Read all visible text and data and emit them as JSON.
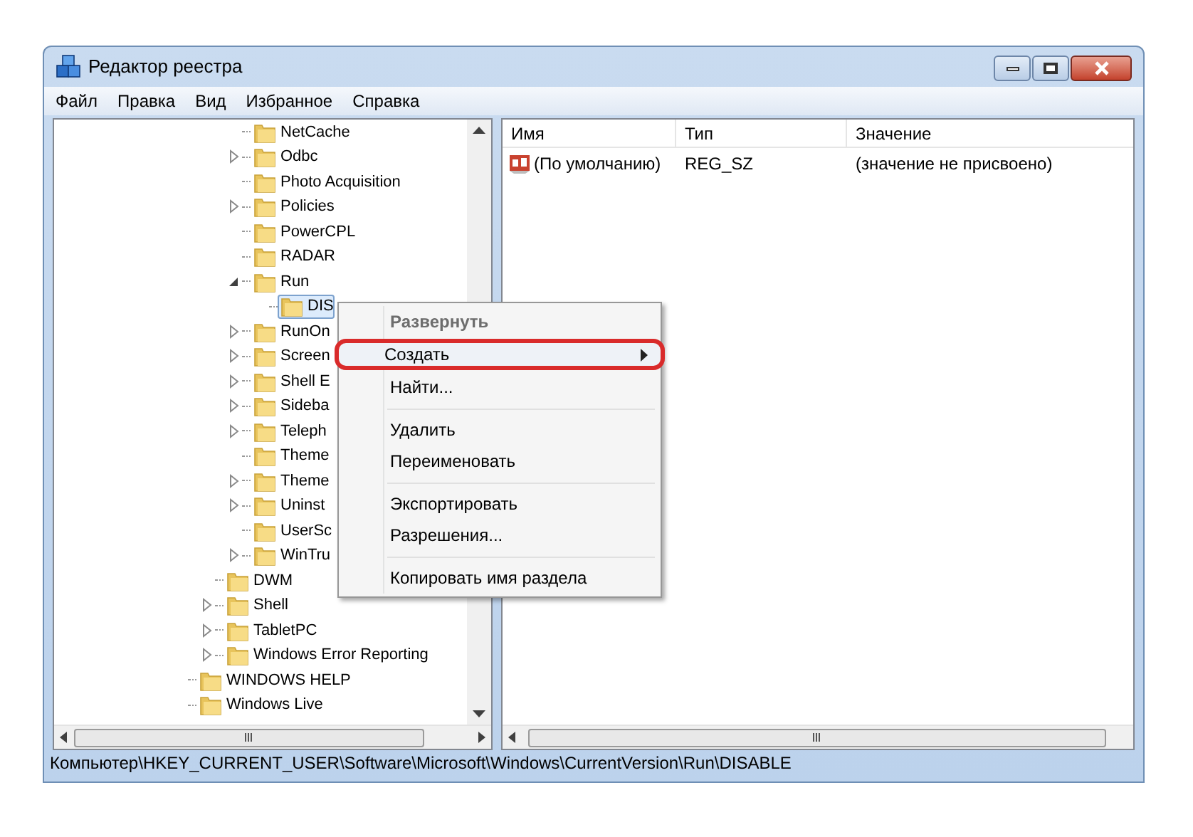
{
  "window": {
    "title": "Редактор реестра"
  },
  "menu_bar": [
    {
      "label": "Файл"
    },
    {
      "label": "Правка"
    },
    {
      "label": "Вид"
    },
    {
      "label": "Избранное"
    },
    {
      "label": "Справка"
    }
  ],
  "tree": {
    "items": [
      {
        "children": [
          {
            "children": [
              {
                "label": "NetCache",
                "selected": false
              },
              {
                "label": "Odbc",
                "expanded": false,
                "selected": false
              },
              {
                "label": "Photo Acquisition",
                "selected": false
              },
              {
                "label": "Policies",
                "expanded": false,
                "selected": false
              },
              {
                "label": "PowerCPL",
                "selected": false
              },
              {
                "label": "RADAR",
                "selected": false
              },
              {
                "label": "Run",
                "expanded": true,
                "selected": false,
                "children": [
                  {
                    "label": "DIS",
                    "selected": true
                  }
                ]
              },
              {
                "label": "RunOn",
                "expanded": false,
                "selected": false
              },
              {
                "label": "Screen",
                "expanded": false,
                "selected": false
              },
              {
                "label": "Shell E",
                "expanded": false,
                "selected": false
              },
              {
                "label": "Sideba",
                "expanded": false,
                "selected": false
              },
              {
                "label": "Teleph",
                "expanded": false,
                "selected": false
              },
              {
                "label": "Theme",
                "selected": false
              },
              {
                "label": "Theme",
                "expanded": false,
                "selected": false
              },
              {
                "label": "Uninst",
                "expanded": false,
                "selected": false
              },
              {
                "label": "UserSc",
                "selected": false
              },
              {
                "label": "WinTru",
                "expanded": false,
                "selected": false
              }
            ]
          },
          {
            "label": "DWM",
            "selected": false
          },
          {
            "label": "Shell",
            "expanded": false,
            "selected": false
          },
          {
            "label": "TabletPC",
            "expanded": false,
            "selected": false
          },
          {
            "label": "Windows Error Reporting",
            "expanded": false,
            "selected": false
          }
        ]
      },
      {
        "label": "WINDOWS HELP",
        "selected": false
      },
      {
        "label": "Windows Live",
        "selected": false
      }
    ]
  },
  "values_table": {
    "columns": [
      "Имя",
      "Тип",
      "Значение"
    ],
    "rows": [
      {
        "name": "(По умолчанию)",
        "type": "REG_SZ",
        "data": "(значение не присвоено)"
      }
    ]
  },
  "context_menu": {
    "items": [
      {
        "kind": "item",
        "label": "Развернуть",
        "default": true,
        "submenu": false,
        "highlighted": false
      },
      {
        "kind": "item",
        "label": "Создать",
        "default": false,
        "submenu": true,
        "highlighted": true
      },
      {
        "kind": "item",
        "label": "Найти...",
        "default": false,
        "submenu": false,
        "highlighted": false
      },
      {
        "kind": "separator"
      },
      {
        "kind": "item",
        "label": "Удалить",
        "default": false,
        "submenu": false,
        "highlighted": false
      },
      {
        "kind": "item",
        "label": "Переименовать",
        "default": false,
        "submenu": false,
        "highlighted": false
      },
      {
        "kind": "separator"
      },
      {
        "kind": "item",
        "label": "Экспортировать",
        "default": false,
        "submenu": false,
        "highlighted": false
      },
      {
        "kind": "item",
        "label": "Разрешения...",
        "default": false,
        "submenu": false,
        "highlighted": false
      },
      {
        "kind": "separator"
      },
      {
        "kind": "item",
        "label": "Копировать имя раздела",
        "default": false,
        "submenu": false,
        "highlighted": false
      }
    ]
  },
  "status_bar": {
    "path": "Компьютер\\HKEY_CURRENT_USER\\Software\\Microsoft\\Windows\\CurrentVersion\\Run\\DISABLE"
  }
}
